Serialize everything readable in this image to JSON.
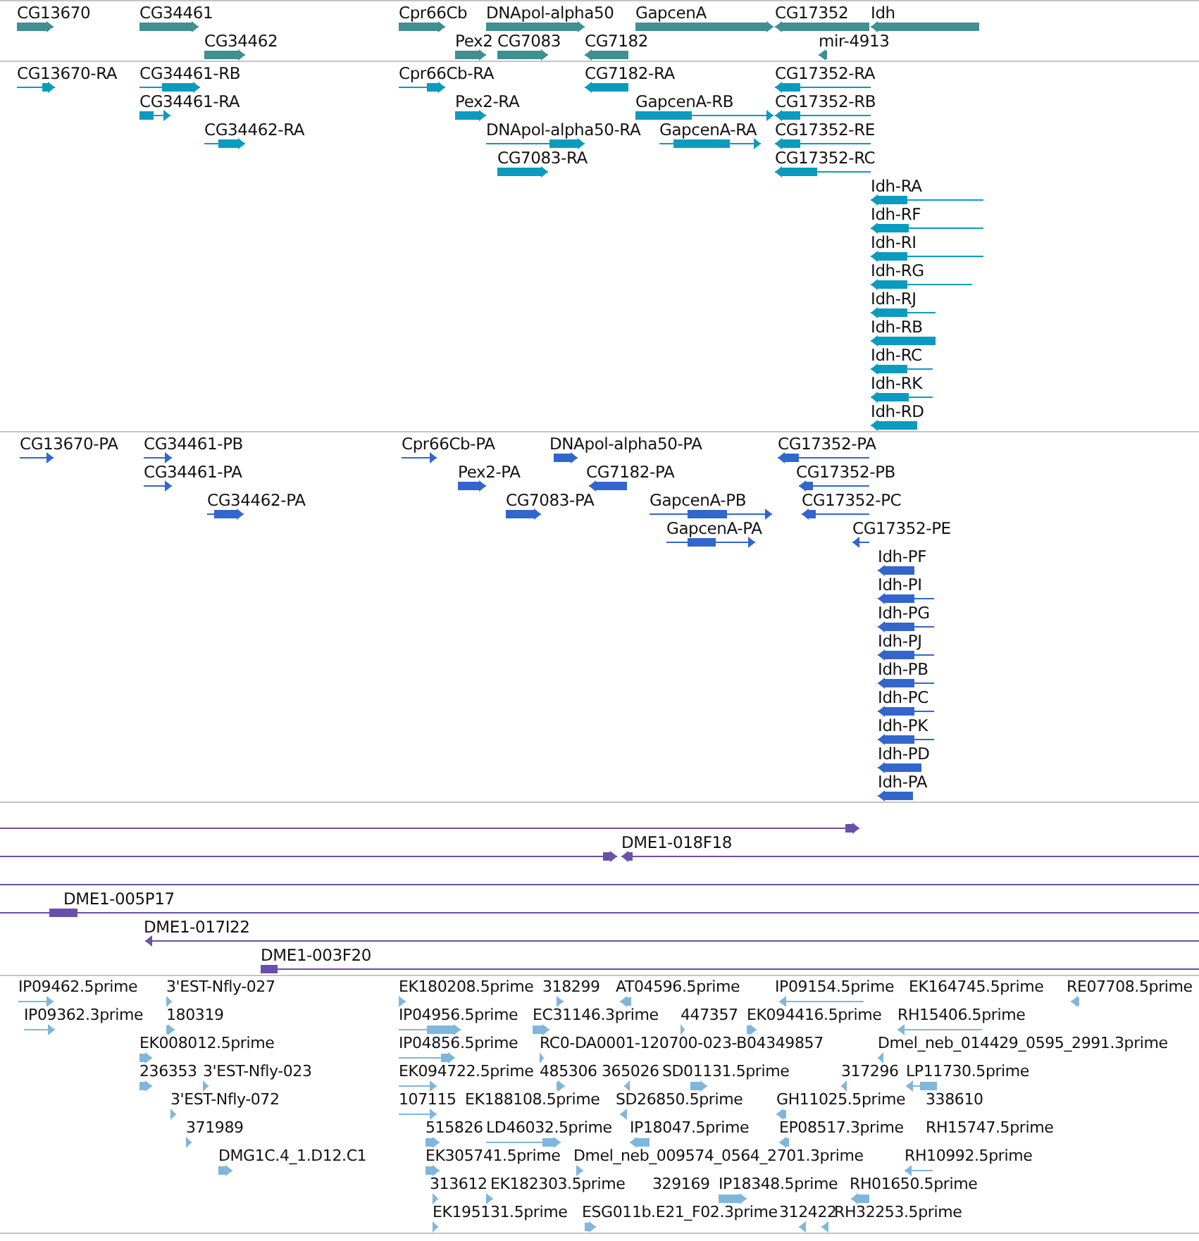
{
  "tracks": [
    {
      "kind": "genes",
      "features": [
        {
          "label": "CG13670",
          "reverse_strand": false
        },
        {
          "label": "CG34461",
          "reverse_strand": false
        },
        {
          "label": "Cpr66Cb",
          "reverse_strand": false
        },
        {
          "label": "DNApol-alpha50",
          "reverse_strand": false
        },
        {
          "label": "GapcenA",
          "reverse_strand": false
        },
        {
          "label": "CG17352",
          "reverse_strand": true
        },
        {
          "label": "Idh",
          "reverse_strand": true
        },
        {
          "label": "CG34462",
          "reverse_strand": false
        },
        {
          "label": "Pex2",
          "reverse_strand": false
        },
        {
          "label": "CG7083",
          "reverse_strand": false
        },
        {
          "label": "CG7182",
          "reverse_strand": true
        },
        {
          "label": "mir-4913",
          "reverse_strand": true
        }
      ]
    },
    {
      "kind": "transcripts",
      "features": [
        {
          "label": "CG13670-RA",
          "reverse_strand": false
        },
        {
          "label": "CG34461-RB",
          "reverse_strand": false
        },
        {
          "label": "Cpr66Cb-RA",
          "reverse_strand": false
        },
        {
          "label": "CG7182-RA",
          "reverse_strand": true
        },
        {
          "label": "CG17352-RA",
          "reverse_strand": true
        },
        {
          "label": "CG34461-RA",
          "reverse_strand": false
        },
        {
          "label": "Pex2-RA",
          "reverse_strand": false
        },
        {
          "label": "GapcenA-RB",
          "reverse_strand": false
        },
        {
          "label": "CG17352-RB",
          "reverse_strand": true
        },
        {
          "label": "CG34462-RA",
          "reverse_strand": false
        },
        {
          "label": "DNApol-alpha50-RA",
          "reverse_strand": false
        },
        {
          "label": "GapcenA-RA",
          "reverse_strand": false
        },
        {
          "label": "CG17352-RE",
          "reverse_strand": true
        },
        {
          "label": "CG7083-RA",
          "reverse_strand": false
        },
        {
          "label": "CG17352-RC",
          "reverse_strand": true
        },
        {
          "label": "Idh-RA",
          "reverse_strand": true
        },
        {
          "label": "Idh-RF",
          "reverse_strand": true
        },
        {
          "label": "Idh-RI",
          "reverse_strand": true
        },
        {
          "label": "Idh-RG",
          "reverse_strand": true
        },
        {
          "label": "Idh-RJ",
          "reverse_strand": true
        },
        {
          "label": "Idh-RB",
          "reverse_strand": true
        },
        {
          "label": "Idh-RC",
          "reverse_strand": true
        },
        {
          "label": "Idh-RK",
          "reverse_strand": true
        },
        {
          "label": "Idh-RD",
          "reverse_strand": true
        }
      ]
    },
    {
      "kind": "proteins",
      "features": [
        {
          "label": "CG13670-PA",
          "reverse_strand": false
        },
        {
          "label": "CG34461-PB",
          "reverse_strand": false
        },
        {
          "label": "Cpr66Cb-PA",
          "reverse_strand": false
        },
        {
          "label": "DNApol-alpha50-PA",
          "reverse_strand": false
        },
        {
          "label": "CG17352-PA",
          "reverse_strand": true
        },
        {
          "label": "CG34461-PA",
          "reverse_strand": false
        },
        {
          "label": "Pex2-PA",
          "reverse_strand": false
        },
        {
          "label": "CG7182-PA",
          "reverse_strand": true
        },
        {
          "label": "CG17352-PB",
          "reverse_strand": true
        },
        {
          "label": "CG34462-PA",
          "reverse_strand": false
        },
        {
          "label": "CG7083-PA",
          "reverse_strand": false
        },
        {
          "label": "GapcenA-PB",
          "reverse_strand": false
        },
        {
          "label": "CG17352-PC",
          "reverse_strand": true
        },
        {
          "label": "GapcenA-PA",
          "reverse_strand": false
        },
        {
          "label": "CG17352-PE",
          "reverse_strand": true
        },
        {
          "label": "Idh-PF",
          "reverse_strand": true
        },
        {
          "label": "Idh-PI",
          "reverse_strand": true
        },
        {
          "label": "Idh-PG",
          "reverse_strand": true
        },
        {
          "label": "Idh-PJ",
          "reverse_strand": true
        },
        {
          "label": "Idh-PB",
          "reverse_strand": true
        },
        {
          "label": "Idh-PC",
          "reverse_strand": true
        },
        {
          "label": "Idh-PK",
          "reverse_strand": true
        },
        {
          "label": "Idh-PD",
          "reverse_strand": true
        },
        {
          "label": "Idh-PA",
          "reverse_strand": true
        }
      ]
    },
    {
      "kind": "clones",
      "features": [
        {
          "reverse_strand": false
        },
        {
          "reverse_strand": false
        },
        {
          "label": "DME1-018F18",
          "reverse_strand": true
        },
        {
          "reverse_strand": false
        },
        {
          "label": "DME1-005P17",
          "reverse_strand": false
        },
        {
          "label": "DME1-017I22",
          "reverse_strand": true
        },
        {
          "label": "DME1-003F20",
          "reverse_strand": false
        }
      ]
    },
    {
      "kind": "ests",
      "features": [
        {
          "label": "IP09462.5prime",
          "reverse_strand": false
        },
        {
          "label": "3'EST-Nfly-027",
          "reverse_strand": false
        },
        {
          "label": "EK180208.5prime",
          "reverse_strand": false
        },
        {
          "label": "318299",
          "reverse_strand": false
        },
        {
          "label": "AT04596.5prime",
          "reverse_strand": true
        },
        {
          "label": "IP09154.5prime",
          "reverse_strand": true
        },
        {
          "label": "EK164745.5prime"
        },
        {
          "label": "RE07708.5prime",
          "reverse_strand": true
        },
        {
          "label": "IP09362.3prime",
          "reverse_strand": false
        },
        {
          "label": "180319",
          "reverse_strand": false
        },
        {
          "label": "IP04956.5prime",
          "reverse_strand": false
        },
        {
          "label": "EC31146.3prime",
          "reverse_strand": false
        },
        {
          "label": "447357",
          "reverse_strand": false
        },
        {
          "label": "EK094416.5prime",
          "reverse_strand": false
        },
        {
          "label": "RH15406.5prime",
          "reverse_strand": true
        },
        {
          "label": "EK008012.5prime",
          "reverse_strand": false
        },
        {
          "label": "IP04856.5prime",
          "reverse_strand": false
        },
        {
          "label": "RC0-DA0001-120700-023-B04349857",
          "reverse_strand": false
        },
        {
          "label": "Dmel_neb_014429_0595_2991.3prime",
          "reverse_strand": true
        },
        {
          "label": "236353",
          "reverse_strand": false
        },
        {
          "label": "3'EST-Nfly-023",
          "reverse_strand": false
        },
        {
          "label": "EK094722.5prime",
          "reverse_strand": false
        },
        {
          "label": "485306",
          "reverse_strand": false
        },
        {
          "label": "365026",
          "reverse_strand": true
        },
        {
          "label": "SD01131.5prime",
          "reverse_strand": false
        },
        {
          "label": "317296",
          "reverse_strand": true
        },
        {
          "label": "LP11730.5prime",
          "reverse_strand": true
        },
        {
          "label": "3'EST-Nfly-072",
          "reverse_strand": false
        },
        {
          "label": "107115",
          "reverse_strand": false
        },
        {
          "label": "EK188108.5prime",
          "reverse_strand": true
        },
        {
          "label": "SD26850.5prime"
        },
        {
          "label": "GH11025.5prime",
          "reverse_strand": true
        },
        {
          "label": "338610"
        },
        {
          "label": "371989",
          "reverse_strand": false
        },
        {
          "label": "515826",
          "reverse_strand": false
        },
        {
          "label": "LD46032.5prime",
          "reverse_strand": false
        },
        {
          "label": "IP18047.5prime",
          "reverse_strand": true
        },
        {
          "label": "EP08517.3prime",
          "reverse_strand": true
        },
        {
          "label": "RH15747.5prime"
        },
        {
          "label": "DMG1C.4_1.D12.C1",
          "reverse_strand": false
        },
        {
          "label": "EK305741.5prime",
          "reverse_strand": false
        },
        {
          "label": "Dmel_neb_009574_0564_2701.3prime",
          "reverse_strand": false
        },
        {
          "label": "RH10992.5prime",
          "reverse_strand": true
        },
        {
          "label": "313612",
          "reverse_strand": false
        },
        {
          "label": "EK182303.5prime",
          "reverse_strand": false
        },
        {
          "label": "329169"
        },
        {
          "label": "IP18348.5prime",
          "reverse_strand": false
        },
        {
          "label": "RH01650.5prime",
          "reverse_strand": true
        },
        {
          "label": "EK195131.5prime",
          "reverse_strand": false
        },
        {
          "label": "ESG011b.E21_F02.3prime",
          "reverse_strand": false
        },
        {
          "label": "312422",
          "reverse_strand": true
        },
        {
          "label": "RH32253.5prime",
          "reverse_strand": true
        }
      ]
    }
  ]
}
